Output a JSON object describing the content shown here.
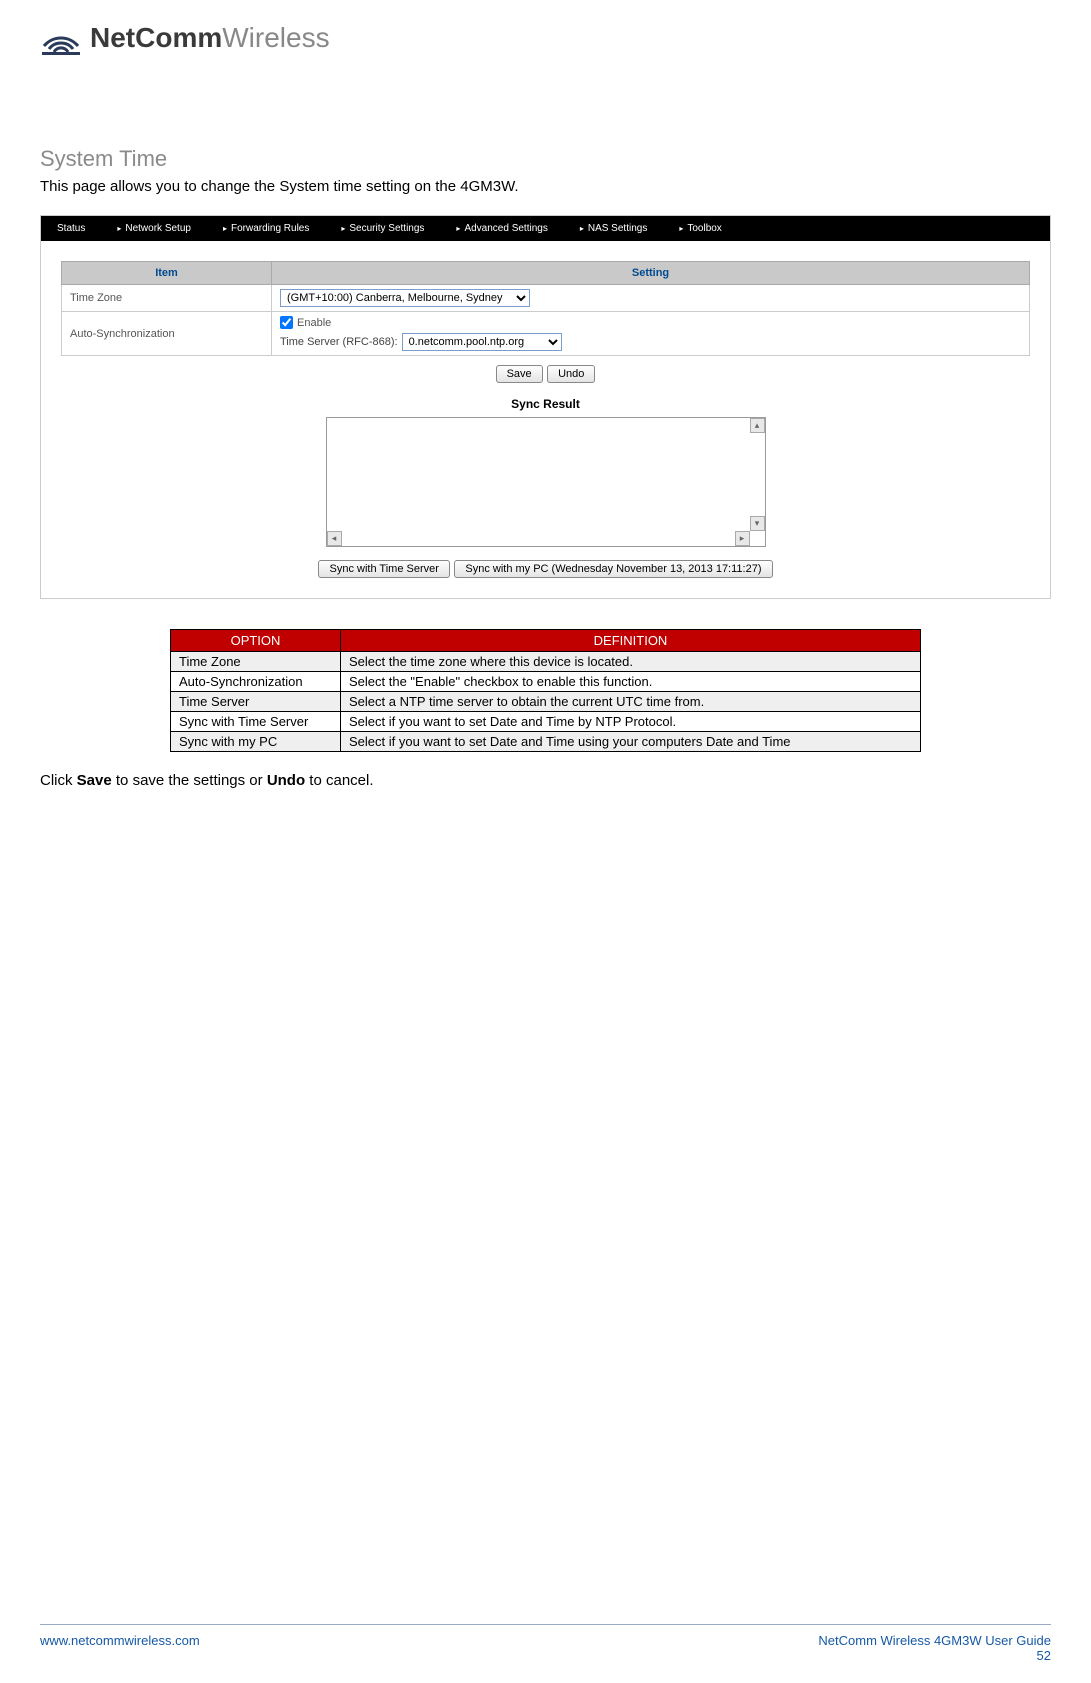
{
  "logo": {
    "bold": "NetComm",
    "light": "Wireless"
  },
  "section_title": "System Time",
  "intro": "This page allows you to change the System time setting on the 4GM3W.",
  "nav": {
    "items": [
      {
        "label": "Status",
        "arrow": false
      },
      {
        "label": "Network Setup",
        "arrow": true
      },
      {
        "label": "Forwarding Rules",
        "arrow": true
      },
      {
        "label": "Security Settings",
        "arrow": true
      },
      {
        "label": "Advanced Settings",
        "arrow": true
      },
      {
        "label": "NAS Settings",
        "arrow": true
      },
      {
        "label": "Toolbox",
        "arrow": true
      }
    ]
  },
  "settings_table": {
    "headers": {
      "item": "Item",
      "setting": "Setting"
    },
    "rows": {
      "time_zone": {
        "label": "Time Zone",
        "value": "(GMT+10:00) Canberra, Melbourne, Sydney"
      },
      "auto_sync": {
        "label": "Auto-Synchronization",
        "enable_label": "Enable",
        "ts_label": "Time Server (RFC-868):",
        "ts_value": "0.netcomm.pool.ntp.org"
      }
    }
  },
  "buttons": {
    "save": "Save",
    "undo": "Undo",
    "sync_server": "Sync with Time Server",
    "sync_pc": "Sync with my PC (Wednesday November 13, 2013 17:11:27)"
  },
  "sync_result_title": "Sync Result",
  "def_table": {
    "headers": {
      "option": "OPTION",
      "definition": "DEFINITION"
    },
    "rows": [
      {
        "option": "Time Zone",
        "definition": "Select the time zone where this device is located."
      },
      {
        "option": "Auto-Synchronization",
        "definition": "Select the \"Enable\" checkbox to enable this function."
      },
      {
        "option": "Time Server",
        "definition": "Select a NTP time server to obtain the current UTC time from."
      },
      {
        "option": "Sync with Time Server",
        "definition": "Select if you want to set Date and Time by NTP Protocol."
      },
      {
        "option": "Sync with my PC",
        "definition": "Select if you want to set Date and Time using your computers Date and Time"
      }
    ]
  },
  "closing": {
    "pre": "Click ",
    "b1": "Save",
    "mid": " to save the settings or ",
    "b2": "Undo",
    "post": " to cancel."
  },
  "footer": {
    "left": "www.netcommwireless.com",
    "right": "NetComm Wireless 4GM3W User Guide",
    "page": "52"
  }
}
